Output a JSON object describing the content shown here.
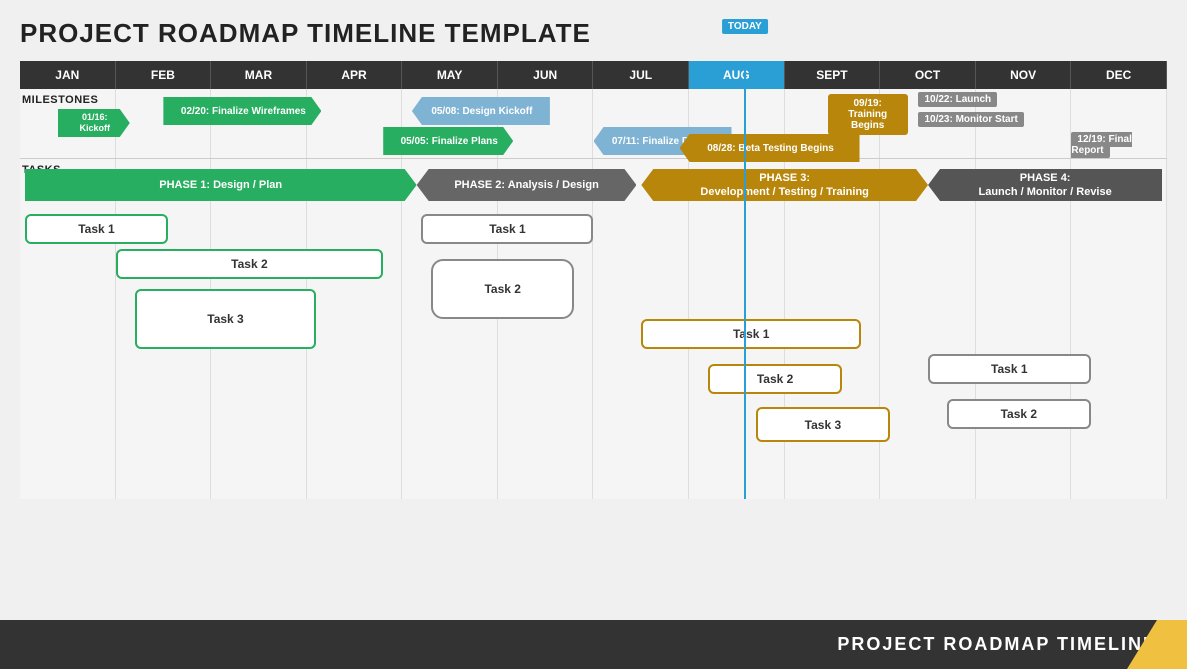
{
  "title": "PROJECT ROADMAP TIMELINE TEMPLATE",
  "footer": {
    "text": "PROJECT ROADMAP TIMELINE"
  },
  "months": [
    "JAN",
    "FEB",
    "MAR",
    "APR",
    "MAY",
    "JUN",
    "JUL",
    "AUG",
    "SEPT",
    "OCT",
    "NOV",
    "DEC"
  ],
  "today_label": "TODAY",
  "sections": {
    "milestones": "MILESTONES",
    "tasks": "TASKS"
  },
  "milestones": [
    {
      "label": "01/16:\nKickoff",
      "date": "01/16",
      "sub": "Kickoff",
      "color": "green",
      "type": "arrow"
    },
    {
      "label": "02/20: Finalize Wireframes",
      "color": "green"
    },
    {
      "label": "05/05: Finalize Plans",
      "color": "green"
    },
    {
      "label": "05/08: Design Kickoff",
      "color": "blue"
    },
    {
      "label": "07/11: Finalize Design",
      "color": "blue"
    },
    {
      "label": "09/19: Training Begins",
      "color": "gold"
    },
    {
      "label": "08/28: Beta Testing Begins",
      "color": "gold"
    },
    {
      "label": "10/22: Launch",
      "color": "gray"
    },
    {
      "label": "10/23: Monitor Start",
      "color": "gray"
    },
    {
      "label": "12/19: Final Report",
      "color": "gray"
    }
  ],
  "phases": [
    {
      "label": "PHASE 1:  Design / Plan",
      "color": "green"
    },
    {
      "label": "PHASE 2:  Analysis / Design",
      "color": "gray"
    },
    {
      "label": "PHASE 3:\nDevelopment / Testing / Training",
      "color": "gold"
    },
    {
      "label": "PHASE 4:\nLaunch / Monitor / Revise",
      "color": "darkgray"
    }
  ],
  "tasks": {
    "phase1": [
      "Task 1",
      "Task 2",
      "Task 3"
    ],
    "phase2": [
      "Task 1",
      "Task 2"
    ],
    "phase3": [
      "Task 1",
      "Task 2",
      "Task 3"
    ],
    "phase4": [
      "Task 1",
      "Task 2"
    ]
  }
}
